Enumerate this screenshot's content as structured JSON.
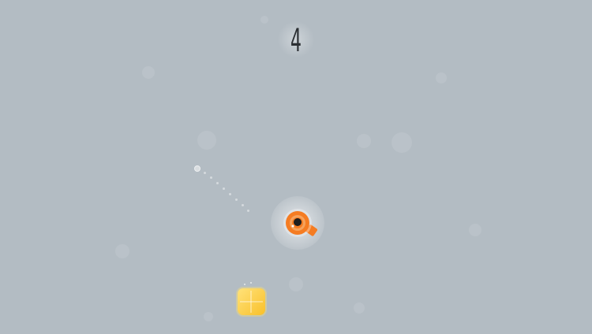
{
  "game": {
    "score": "4",
    "colors": {
      "background": "#b3bcc3",
      "player_primary": "#f57c22",
      "player_core": "#1e1e1e",
      "pickup": "#f9c02a",
      "score_text": "#2b2f33"
    },
    "entities": {
      "player": {
        "icon": "orange-ring-ship-icon"
      },
      "pickup": {
        "icon": "yellow-cube-icon"
      },
      "projectile": {
        "icon": "white-orb-icon"
      }
    }
  }
}
